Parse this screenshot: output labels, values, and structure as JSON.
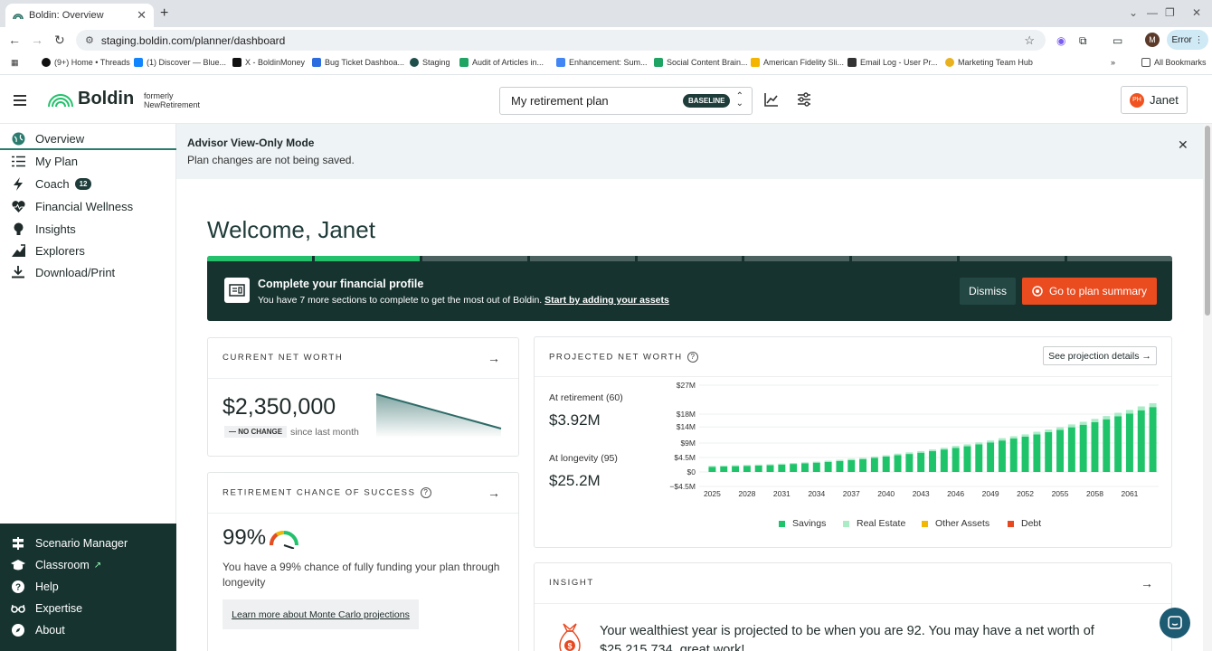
{
  "browser": {
    "tab_title": "Boldin: Overview",
    "url": "staging.boldin.com/planner/dashboard",
    "error_label": "Error",
    "profile_initial": "M",
    "bookmarks": [
      "(9+) Home • Threads",
      "(1) Discover — Blue...",
      "X - BoldinMoney",
      "Bug Ticket Dashboa...",
      "Staging",
      "Audit of Articles in...",
      "Enhancement: Sum...",
      "Social Content Brain...",
      "American Fidelity Sli...",
      "Email Log - User Pr...",
      "Marketing Team Hub"
    ],
    "all_bookmarks": "All Bookmarks"
  },
  "header": {
    "logo": "Boldin",
    "formerly_1": "formerly",
    "formerly_2": "NewRetirement",
    "plan_name": "My retirement plan",
    "plan_badge": "BASELINE",
    "user_initials": "PH",
    "user_name": "Janet"
  },
  "sidebar": {
    "items": [
      {
        "label": "Overview"
      },
      {
        "label": "My Plan"
      },
      {
        "label": "Coach",
        "badge": "12"
      },
      {
        "label": "Financial Wellness"
      },
      {
        "label": "Insights"
      },
      {
        "label": "Explorers"
      },
      {
        "label": "Download/Print"
      }
    ],
    "bottom_items": [
      {
        "label": "Scenario Manager"
      },
      {
        "label": "Classroom"
      },
      {
        "label": "Help"
      },
      {
        "label": "Expertise"
      },
      {
        "label": "About"
      }
    ]
  },
  "advisor_banner": {
    "title": "Advisor View-Only Mode",
    "message": "Plan changes are not being saved."
  },
  "welcome": "Welcome, Janet",
  "profile_banner": {
    "title": "Complete your financial profile",
    "text": "You have 7 more sections to complete to get the most out of Boldin.",
    "link": "Start by adding your assets",
    "dismiss": "Dismiss",
    "cta": "Go to plan summary",
    "segments_total": 9,
    "segments_complete": 2
  },
  "net_worth": {
    "label": "CURRENT NET WORTH",
    "value": "$2,350,000",
    "change_badge": "— NO CHANGE",
    "change_text": "since last month"
  },
  "success": {
    "label": "RETIREMENT CHANCE OF SUCCESS",
    "value": "99%",
    "percent": 99,
    "description": "You have a 99% chance of fully funding your plan through longevity",
    "learn_more": "Learn more about Monte Carlo projections"
  },
  "projected": {
    "label": "PROJECTED NET WORTH",
    "details_btn": "See projection details",
    "retire_label": "At retirement (60)",
    "retire_value": "$3.92M",
    "longevity_label": "At longevity (95)",
    "longevity_value": "$25.2M"
  },
  "chart_data": {
    "type": "bar",
    "y_ticks": [
      "$27M",
      "$18M",
      "$14M",
      "$9M",
      "$4.5M",
      "$0",
      "−$4.5M"
    ],
    "x_ticks": [
      "2025",
      "2028",
      "2031",
      "2034",
      "2037",
      "2040",
      "2043",
      "2046",
      "2049",
      "2052",
      "2055",
      "2058",
      "2061"
    ],
    "years": [
      2025,
      2026,
      2027,
      2028,
      2029,
      2030,
      2031,
      2032,
      2033,
      2034,
      2035,
      2036,
      2037,
      2038,
      2039,
      2040,
      2041,
      2042,
      2043,
      2044,
      2045,
      2046,
      2047,
      2048,
      2049,
      2050,
      2051,
      2052,
      2053,
      2054,
      2055,
      2056,
      2057,
      2058,
      2059,
      2060,
      2061,
      2062,
      2063
    ],
    "series": [
      {
        "name": "Savings",
        "color": "#1fc46a",
        "values": [
          1.6,
          1.7,
          1.8,
          1.9,
          2.0,
          2.1,
          2.3,
          2.5,
          2.7,
          2.9,
          3.1,
          3.4,
          3.7,
          4.0,
          4.4,
          4.8,
          5.2,
          5.6,
          6.0,
          6.5,
          7.0,
          7.5,
          8.0,
          8.6,
          9.2,
          9.8,
          10.4,
          11.0,
          11.7,
          12.4,
          13.1,
          13.9,
          14.7,
          15.5,
          16.4,
          17.3,
          18.2,
          19.2,
          20.2
        ]
      },
      {
        "name": "Real Estate",
        "color": "#a9ecc6",
        "values": [
          0.3,
          0.3,
          0.3,
          0.3,
          0.3,
          0.3,
          0.3,
          0.3,
          0.3,
          0.3,
          0.4,
          0.4,
          0.4,
          0.4,
          0.4,
          0.4,
          0.5,
          0.5,
          0.5,
          0.5,
          0.5,
          0.6,
          0.6,
          0.6,
          0.6,
          0.7,
          0.7,
          0.7,
          0.8,
          0.8,
          0.8,
          0.9,
          0.9,
          1.0,
          1.0,
          1.1,
          1.1,
          1.2,
          1.2
        ]
      },
      {
        "name": "Other Assets",
        "color": "#f2b705",
        "values": [
          0,
          0,
          0,
          0,
          0,
          0,
          0,
          0,
          0,
          0,
          0,
          0,
          0,
          0,
          0,
          0,
          0,
          0,
          0,
          0,
          0,
          0,
          0,
          0,
          0,
          0,
          0,
          0,
          0,
          0,
          0,
          0,
          0,
          0,
          0,
          0,
          0,
          0,
          0
        ]
      },
      {
        "name": "Debt",
        "color": "#e8481f",
        "values": [
          0,
          0,
          0,
          0,
          0,
          0,
          0,
          0,
          0,
          0,
          0,
          0,
          0,
          0,
          0,
          0,
          0,
          0,
          0,
          0,
          0,
          0,
          0,
          0,
          0,
          0,
          0,
          0,
          0,
          0,
          0,
          0,
          0,
          0,
          0,
          0,
          0,
          0,
          0
        ]
      }
    ],
    "ylim": [
      -4.5,
      27
    ]
  },
  "insight": {
    "label": "INSIGHT",
    "text": "Your wealthiest year is projected to be when you are 92. You may have a net worth of $25,215,734, great work!"
  }
}
